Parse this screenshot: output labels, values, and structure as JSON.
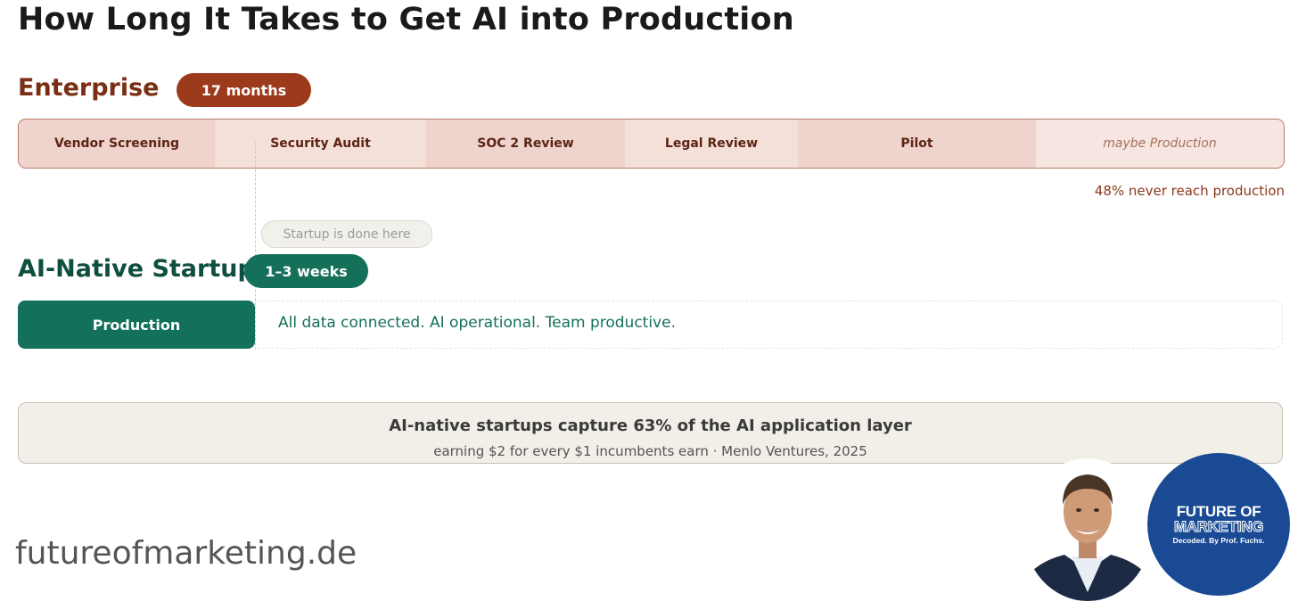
{
  "title": "How Long It Takes to Get AI into Production",
  "enterprise": {
    "label": "Enterprise",
    "duration": "17 months",
    "stages": [
      "Vendor Screening",
      "Security Audit",
      "SOC 2 Review",
      "Legal Review",
      "Pilot",
      "maybe Production"
    ],
    "note": "48% never reach production"
  },
  "startup": {
    "done_badge": "Startup is done here",
    "label": "AI-Native Startup",
    "duration": "1–3 weeks",
    "stage": "Production",
    "description": "All data connected. AI operational. Team productive."
  },
  "footer": {
    "headline": "AI-native startups capture 63% of the AI application layer",
    "subline": "earning $2 for every $1 incumbents earn · Menlo Ventures, 2025"
  },
  "branding": {
    "website": "futureofmarketing.de",
    "logo": {
      "line1": "FUTURE OF",
      "line2": "MARKETING",
      "line3": "Decoded. By Prof. Fuchs."
    },
    "portrait_icon": "presenter-portrait"
  },
  "colors": {
    "enterprise": "#9c3a1c",
    "startup": "#15705a",
    "logo_bg": "#1a4a93"
  }
}
